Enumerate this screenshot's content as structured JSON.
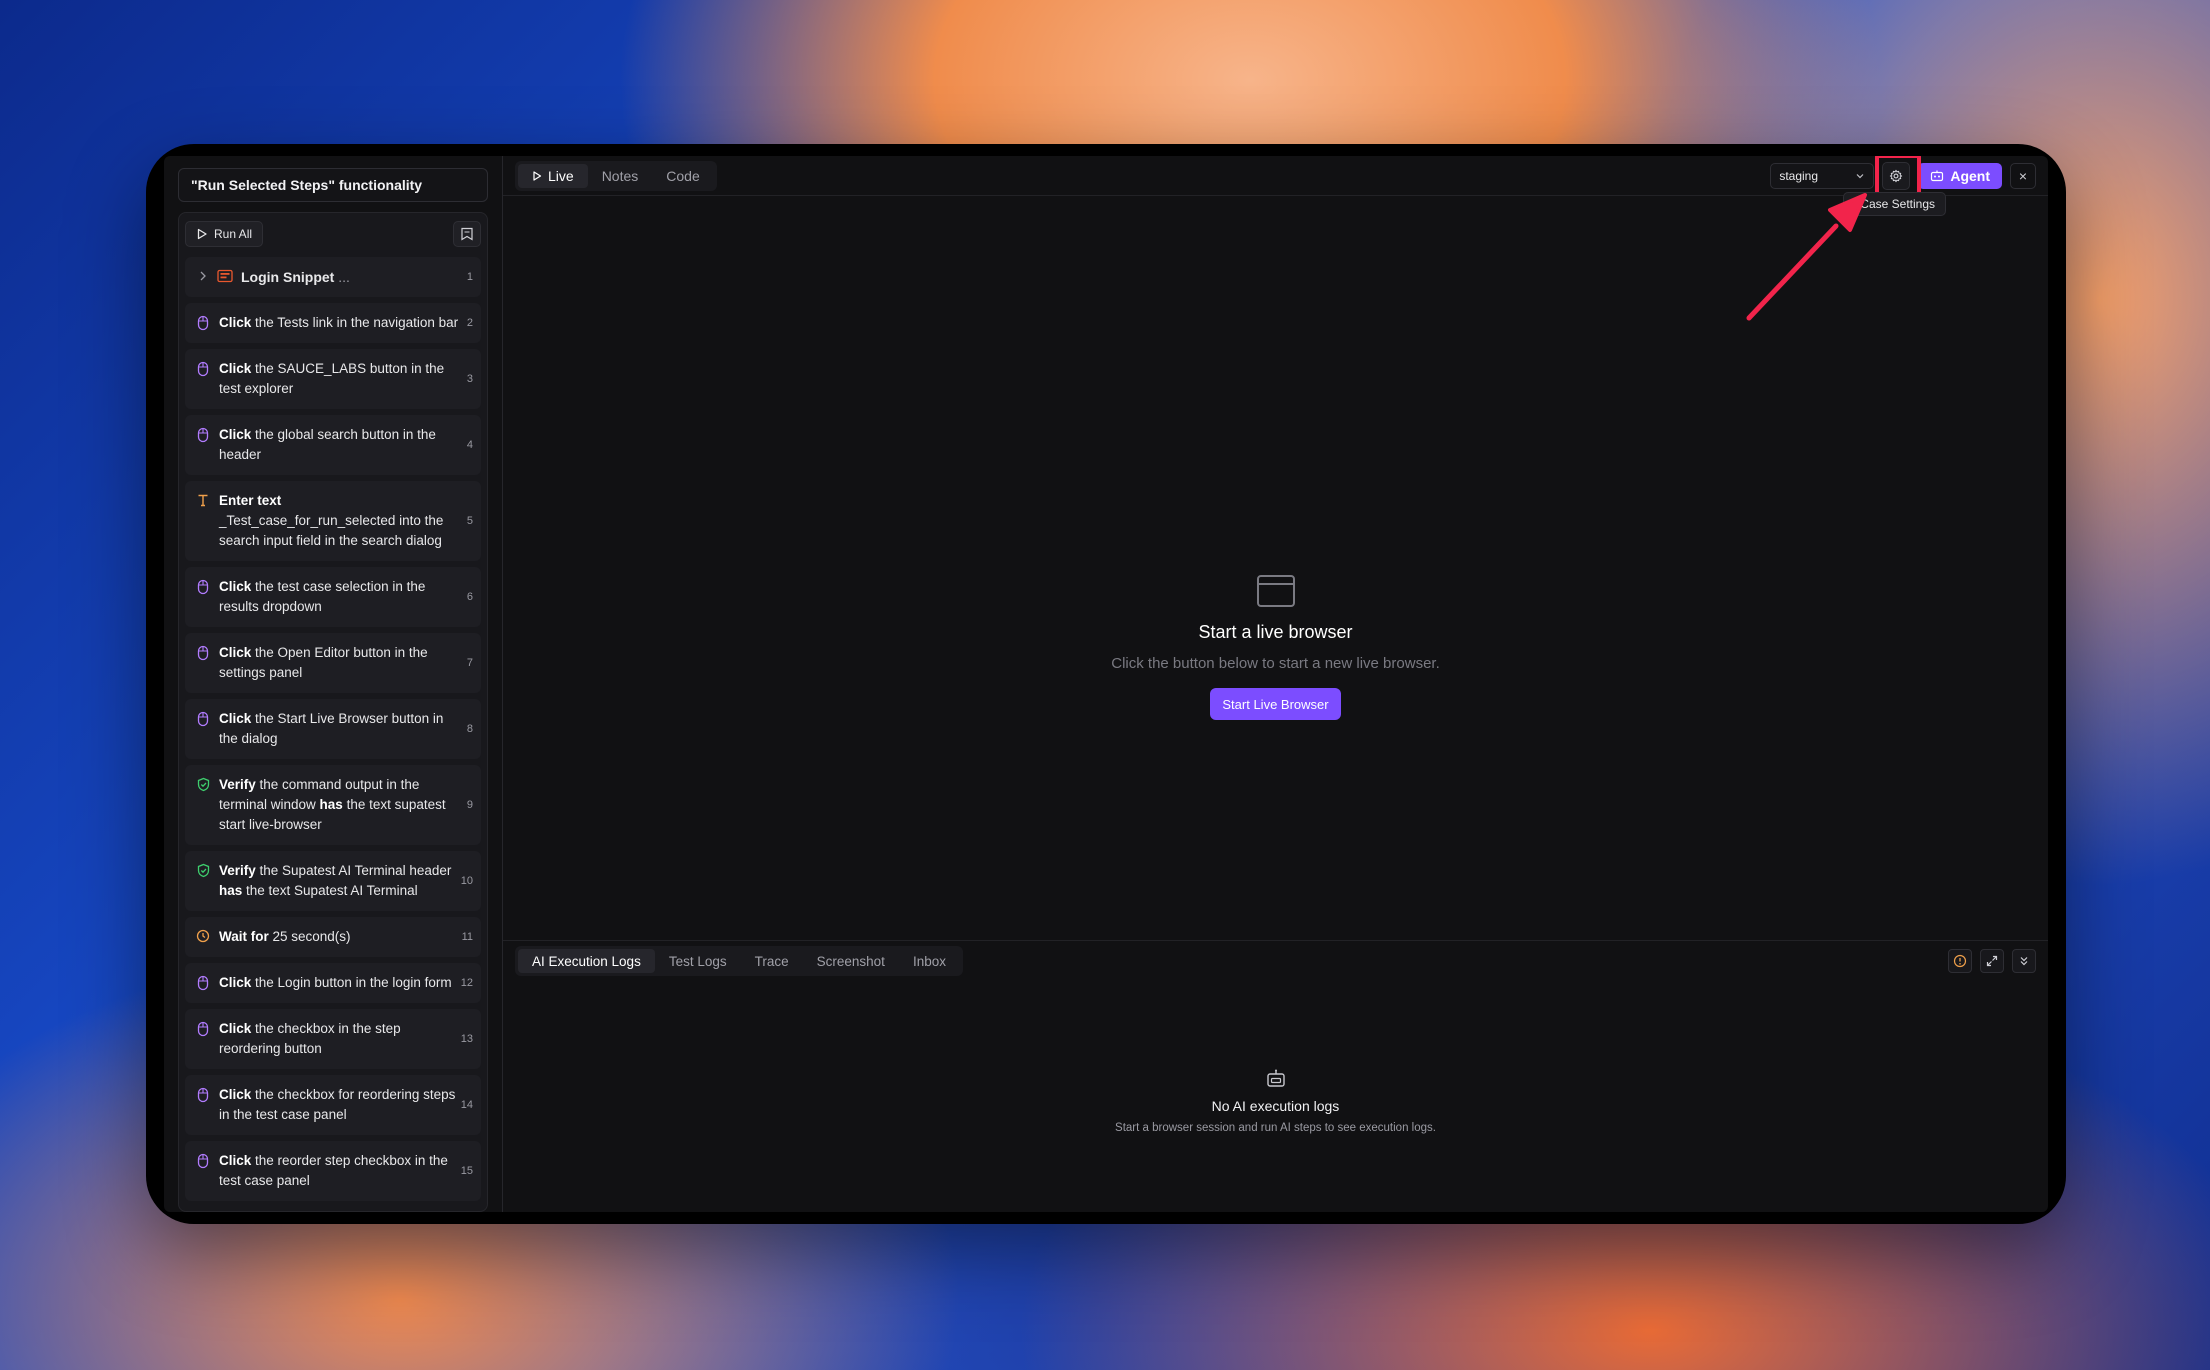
{
  "sidebar": {
    "title": "\"Run Selected Steps\" functionality",
    "run_all_label": "Run All",
    "snippet": {
      "label": "Login Snippet",
      "suffix": "...",
      "num": "1"
    },
    "steps": [
      {
        "icon": "mouse",
        "action": "Click",
        "rest": " the Tests link in the navigation bar",
        "num": "2"
      },
      {
        "icon": "mouse",
        "action": "Click",
        "rest": " the SAUCE_LABS button in the test explorer",
        "num": "3"
      },
      {
        "icon": "mouse",
        "action": "Click",
        "rest": " the global search button in the header",
        "num": "4"
      },
      {
        "icon": "text",
        "action": "Enter text",
        "rest": " _Test_case_for_run_selected  into the search input field in the search dialog",
        "num": "5"
      },
      {
        "icon": "mouse",
        "action": "Click",
        "rest": " the test case selection in the results dropdown",
        "num": "6"
      },
      {
        "icon": "mouse",
        "action": "Click",
        "rest": " the Open Editor button in the settings panel",
        "num": "7"
      },
      {
        "icon": "mouse",
        "action": "Click",
        "rest": " the Start Live Browser button in the dialog",
        "num": "8"
      },
      {
        "icon": "shield",
        "action": "Verify",
        "rest": " the command output in the terminal window ",
        "bold2": "has",
        "rest2": " the text supatest start live-browser",
        "num": "9"
      },
      {
        "icon": "shield",
        "action": "Verify",
        "rest": " the Supatest AI Terminal header ",
        "bold2": "has",
        "rest2": " the text Supatest AI Terminal",
        "num": "10"
      },
      {
        "icon": "clock",
        "action": "Wait for",
        "rest": " 25 second(s)",
        "num": "11"
      },
      {
        "icon": "mouse",
        "action": "Click",
        "rest": " the Login button in the login form",
        "num": "12"
      },
      {
        "icon": "mouse",
        "action": "Click",
        "rest": " the checkbox in the step reordering button",
        "num": "13"
      },
      {
        "icon": "mouse",
        "action": "Click",
        "rest": " the checkbox for reordering steps in the test case panel",
        "num": "14"
      },
      {
        "icon": "mouse",
        "action": "Click",
        "rest": " the reorder step checkbox in the test case panel",
        "num": "15"
      }
    ]
  },
  "topbar": {
    "tabs": [
      "Live",
      "Notes",
      "Code"
    ],
    "env_value": "staging",
    "tooltip": "t Case Settings",
    "agent_label": "Agent",
    "close_label": "×"
  },
  "live": {
    "title": "Start a live browser",
    "subtitle": "Click the button below to start a new live browser.",
    "button": "Start Live Browser"
  },
  "logs": {
    "tabs": [
      "AI Execution Logs",
      "Test Logs",
      "Trace",
      "Screenshot",
      "Inbox"
    ],
    "empty_title": "No AI execution logs",
    "empty_sub": "Start a browser session and run AI steps to see execution logs."
  },
  "colors": {
    "accent": "#7c4dff",
    "highlight": "#f2244b",
    "mouse_icon": "#b27cff",
    "text_icon": "#f0a04b",
    "verify_icon": "#3ecf6e",
    "wait_icon": "#f0a04b"
  }
}
